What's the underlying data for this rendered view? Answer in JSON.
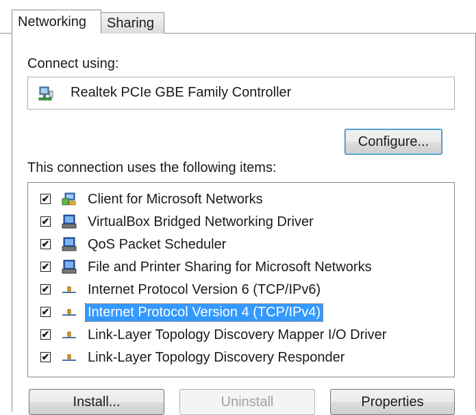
{
  "tabs": [
    {
      "label": "Networking"
    },
    {
      "label": "Sharing"
    }
  ],
  "connect_using_label": "Connect using:",
  "adapter": {
    "name": "Realtek PCIe GBE Family Controller",
    "icon": "network-adapter-icon"
  },
  "configure_label": "Configure...",
  "items_label": "This connection uses the following items:",
  "items": [
    {
      "label": "Client for Microsoft Networks",
      "checked": true,
      "icon": "network-client-icon"
    },
    {
      "label": "VirtualBox Bridged Networking Driver",
      "checked": true,
      "icon": "service-icon"
    },
    {
      "label": "QoS Packet Scheduler",
      "checked": true,
      "icon": "service-icon"
    },
    {
      "label": "File and Printer Sharing for Microsoft Networks",
      "checked": true,
      "icon": "service-icon"
    },
    {
      "label": "Internet Protocol Version 6 (TCP/IPv6)",
      "checked": true,
      "icon": "protocol-icon"
    },
    {
      "label": "Internet Protocol Version 4 (TCP/IPv4)",
      "checked": true,
      "icon": "protocol-icon",
      "selected": true
    },
    {
      "label": "Link-Layer Topology Discovery Mapper I/O Driver",
      "checked": true,
      "icon": "protocol-icon"
    },
    {
      "label": "Link-Layer Topology Discovery Responder",
      "checked": true,
      "icon": "protocol-icon"
    }
  ],
  "buttons": {
    "install": "Install...",
    "uninstall": "Uninstall",
    "properties": "Properties"
  },
  "colors": {
    "selection": "#3399ff",
    "border": "#828790"
  }
}
